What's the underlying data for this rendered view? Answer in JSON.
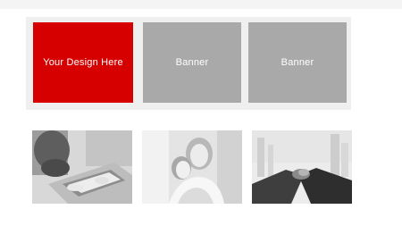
{
  "banners": [
    {
      "label": "Your Design Here",
      "color": "#d60000"
    },
    {
      "label": "Banner",
      "color": "#a9a9a9"
    },
    {
      "label": "Banner",
      "color": "#a9a9a9"
    }
  ],
  "news": {
    "section_label": "",
    "articles": [
      {
        "image": "laptop-hands-photo",
        "date": "",
        "title": ""
      },
      {
        "image": "mother-daughter-photo",
        "date": "",
        "title": ""
      },
      {
        "image": "handshake-city-photo",
        "date": "",
        "title": ""
      }
    ]
  }
}
